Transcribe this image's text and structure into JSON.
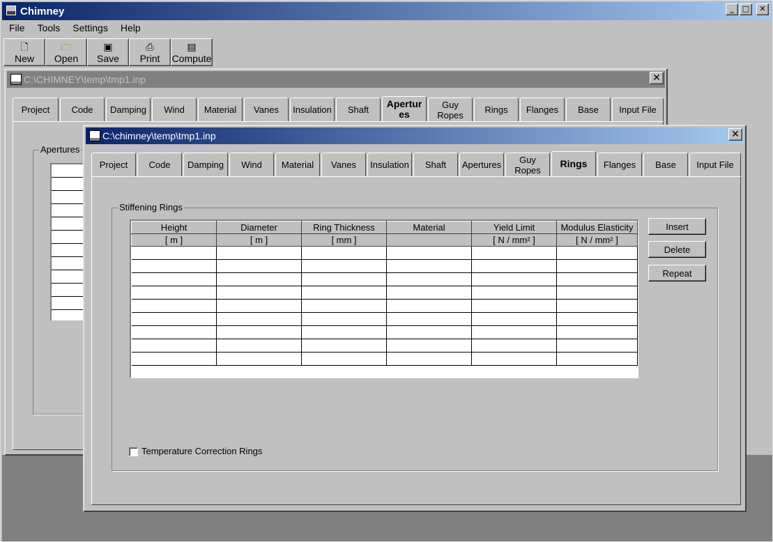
{
  "app": {
    "title": "Chimney",
    "icon": "chimney-app-icon"
  },
  "window_controls": {
    "minimize": "_",
    "maximize": "□",
    "close": "✕"
  },
  "menu": [
    "File",
    "Tools",
    "Settings",
    "Help"
  ],
  "toolbar": [
    {
      "label": "New",
      "icon": "new-file-icon"
    },
    {
      "label": "Open",
      "icon": "open-folder-icon"
    },
    {
      "label": "Save",
      "icon": "save-disk-icon"
    },
    {
      "label": "Print",
      "icon": "printer-icon"
    },
    {
      "label": "Compute",
      "icon": "compute-icon"
    }
  ],
  "back_window": {
    "title": "C:\\CHIMNEY\\temp\\tmp1.inp",
    "close": "✕",
    "tabs": [
      "Project",
      "Code",
      "Damping",
      "Wind",
      "Material",
      "Vanes",
      "Insulation",
      "Shaft",
      "Apertur es",
      "Guy Ropes",
      "Rings",
      "Flanges",
      "Base",
      "Input File"
    ],
    "selected_tab": "Apertur es",
    "group_label": "Apertures"
  },
  "front_window": {
    "title": "C:\\chimney\\temp\\tmp1.inp",
    "close": "✕",
    "tabs": [
      "Project",
      "Code",
      "Damping",
      "Wind",
      "Material",
      "Vanes",
      "Insulation",
      "Shaft",
      "Apertures",
      "Guy Ropes",
      "Rings",
      "Flanges",
      "Base",
      "Input File"
    ],
    "selected_tab": "Rings",
    "group_label": "Stiffening Rings",
    "table": {
      "columns": [
        "Height",
        "Diameter",
        "Ring Thickness",
        "Material",
        "Yield Limit",
        "Modulus Elasticity"
      ],
      "units": [
        "[ m ]",
        "[ m ]",
        "[ mm ]",
        "",
        "[ N / mm² ]",
        "[ N / mm² ]"
      ],
      "rows": [
        [
          "",
          "",
          "",
          "",
          "",
          ""
        ],
        [
          "",
          "",
          "",
          "",
          "",
          ""
        ],
        [
          "",
          "",
          "",
          "",
          "",
          ""
        ],
        [
          "",
          "",
          "",
          "",
          "",
          ""
        ],
        [
          "",
          "",
          "",
          "",
          "",
          ""
        ],
        [
          "",
          "",
          "",
          "",
          "",
          ""
        ],
        [
          "",
          "",
          "",
          "",
          "",
          ""
        ],
        [
          "",
          "",
          "",
          "",
          "",
          ""
        ],
        [
          "",
          "",
          "",
          "",
          "",
          ""
        ]
      ]
    },
    "buttons": {
      "insert": "Insert",
      "delete": "Delete",
      "repeat": "Repeat"
    },
    "checkbox": {
      "label": "Temperature Correction Rings",
      "checked": false
    }
  }
}
